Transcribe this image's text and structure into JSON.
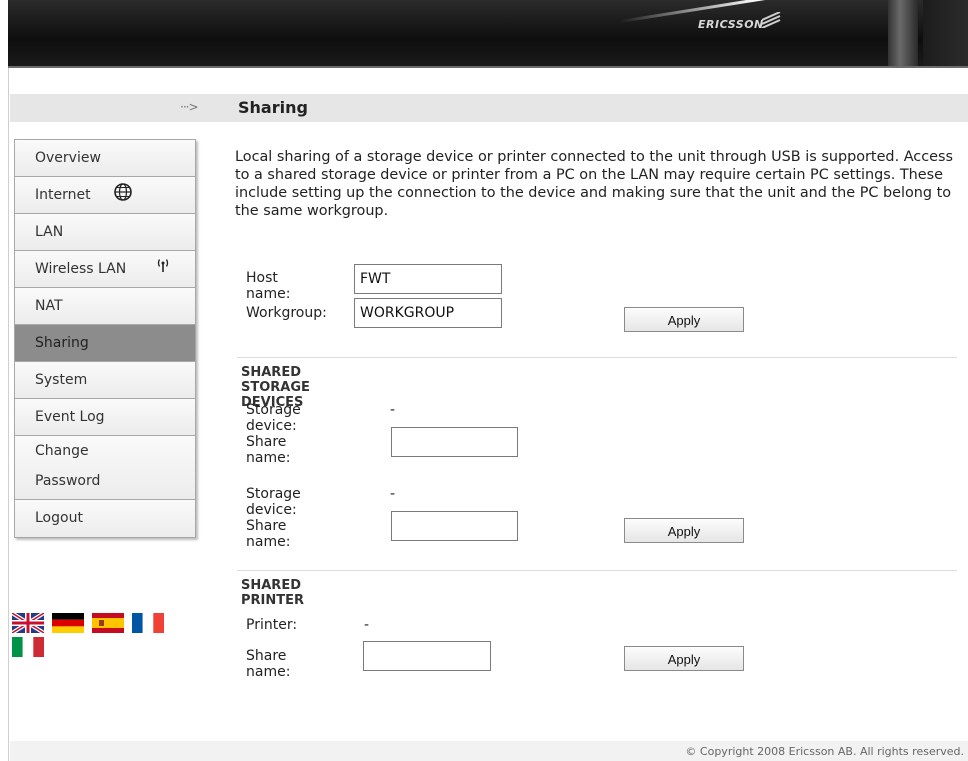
{
  "header": {
    "logo_text": "ERICSSON"
  },
  "title_bar": {
    "arrow": "···>",
    "title": "Sharing"
  },
  "nav": {
    "items": [
      {
        "label": "Overview"
      },
      {
        "label": "Internet"
      },
      {
        "label": "LAN"
      },
      {
        "label": "Wireless LAN"
      },
      {
        "label": "NAT"
      },
      {
        "label": "Sharing"
      },
      {
        "label": "System"
      },
      {
        "label": "Event Log"
      },
      {
        "label_line1": "Change",
        "label_line2": "Password"
      },
      {
        "label": "Logout"
      }
    ],
    "active": "Sharing"
  },
  "main": {
    "intro": "Local sharing of a storage device or printer connected to the unit through USB is supported. Access to a shared storage device or printer from a PC on the LAN may require certain PC settings. These include setting up the connection to the device and making sure that the unit and the PC belong to the same workgroup.",
    "host_name_label": "Host name:",
    "host_name_value": "FWT",
    "workgroup_label": "Workgroup:",
    "workgroup_value": "WORKGROUP",
    "apply_label": "Apply",
    "storage_section_title": "SHARED STORAGE DEVICES",
    "storage_devices": [
      {
        "device_label": "Storage device:",
        "device_value": "-",
        "share_label": "Share name:",
        "share_value": ""
      },
      {
        "device_label": "Storage device:",
        "device_value": "-",
        "share_label": "Share name:",
        "share_value": ""
      }
    ],
    "printer_section_title": "SHARED PRINTER",
    "printer_label": "Printer:",
    "printer_value": "-",
    "printer_share_label": "Share name:",
    "printer_share_value": ""
  },
  "footer": {
    "copyright": "© Copyright 2008 Ericsson AB. All rights reserved."
  },
  "colors": {
    "active_nav": "#8c8c8c",
    "header_bg": "#111111",
    "title_bar_bg": "#e6e6e6"
  }
}
